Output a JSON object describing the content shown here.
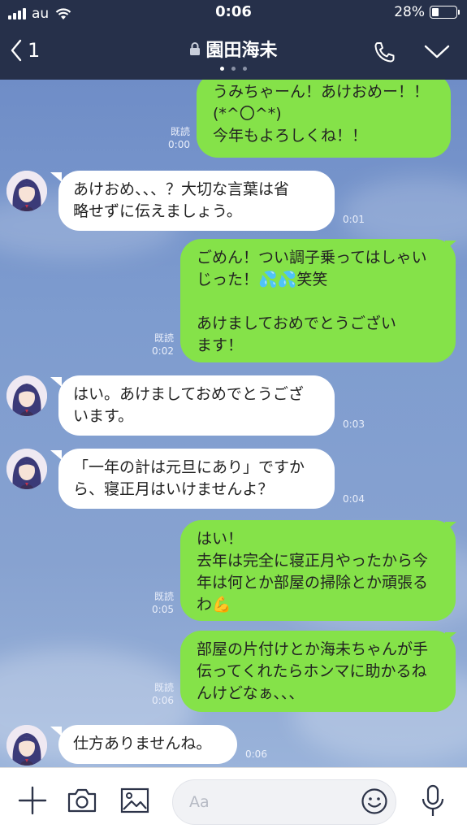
{
  "status_bar": {
    "carrier": "au",
    "time": "0:06",
    "battery": "28%",
    "battery_level": 0.28
  },
  "header": {
    "back_count": "1",
    "title": "園田海未",
    "page_dots": 3,
    "active_dot": 0
  },
  "messages": [
    {
      "from": "me",
      "lines": "うみちゃーん！あけおめー！！\n(*^〇^*)\n今年もよろしくね！！",
      "read": "既読",
      "time": "0:00"
    },
    {
      "from": "other",
      "lines": "あけおめ、、、？大切な言葉は省\n略せずに伝えましょう。",
      "time": "0:01"
    },
    {
      "from": "me",
      "lines": "ごめん！つい調子乗ってはしゃい\nじった！💦💦笑笑\n\nあけましておめでとうござい\nます！",
      "read": "既読",
      "time": "0:02"
    },
    {
      "from": "other",
      "lines": "はい。あけましておめでとうござ\nいます。",
      "time": "0:03"
    },
    {
      "from": "other",
      "lines": "「一年の計は元旦にあり」ですか\nら、寝正月はいけませんよ？",
      "time": "0:04"
    },
    {
      "from": "me",
      "lines": "はい！\n去年は完全に寝正月やったから今\n年は何とか部屋の掃除とか頑張る\nわ💪",
      "read": "既読",
      "time": "0:05"
    },
    {
      "from": "me",
      "lines": "部屋の片付けとか海未ちゃんが手\n伝ってくれたらホンマに助かるね\nんけどなぁ、、、",
      "read": "既読",
      "time": "0:06"
    },
    {
      "from": "other",
      "lines": "仕方ありませんね。",
      "time": "0:06"
    }
  ],
  "input": {
    "placeholder": "Aa"
  },
  "icons": {
    "back": "chevron-left-icon",
    "lock": "lock-icon",
    "call": "phone-icon",
    "menu": "chevron-down-icon",
    "plus": "plus-icon",
    "camera": "camera-icon",
    "image": "image-icon",
    "emoji": "smiley-icon",
    "mic": "mic-icon"
  },
  "colors": {
    "bar": "#26304a",
    "my_bubble": "#85e249",
    "their_bubble": "#ffffff",
    "chat_bg": "#7c93c4"
  }
}
